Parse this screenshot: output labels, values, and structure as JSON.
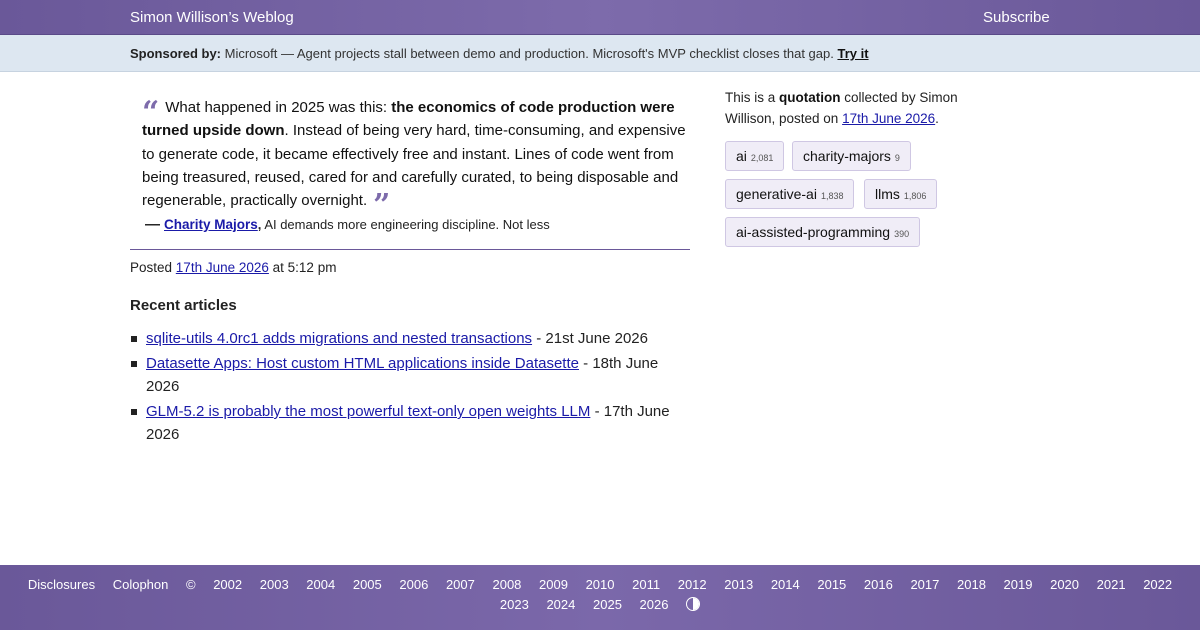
{
  "header": {
    "site_title": "Simon Willison’s Weblog",
    "subscribe": "Subscribe"
  },
  "sponsor": {
    "label": "Sponsored by:",
    "text": "Microsoft — Agent projects stall between demo and production. Microsoft's MVP checklist closes that gap.",
    "link": "Try it"
  },
  "quote": {
    "open_mark": "“",
    "text_before": "What happened in 2025 was this: ",
    "emphasis": "the economics of code production were turned upside down",
    "text_after": ". Instead of being very hard, time-consuming, and expensive to generate code, it became effectively free and instant. Lines of code went from being treasured, reused, cared for and carefully curated, to being disposable and regenerable, practically overnight.",
    "close_mark": "”",
    "cite_dash": "—",
    "author": "Charity Majors",
    "source": "AI demands more engineering discipline. Not less"
  },
  "posted": {
    "prefix": "Posted",
    "date": "17th June 2026",
    "time": "at 5:12 pm"
  },
  "recent": {
    "heading": "Recent articles",
    "items": [
      {
        "title": "sqlite-utils 4.0rc1 adds migrations and nested transactions",
        "date": "- 21st June 2026"
      },
      {
        "title": "Datasette Apps: Host custom HTML applications inside Datasette",
        "date": "- 18th June 2026"
      },
      {
        "title": "GLM-5.2 is probably the most powerful text-only open weights LLM",
        "date": "- 17th June 2026"
      }
    ]
  },
  "sidebar": {
    "about_prefix": "This is a",
    "about_type": "quotation",
    "about_middle": "collected by Simon Willison, posted on",
    "about_date": "17th June 2026",
    "about_end": ".",
    "tags": [
      {
        "name": "ai",
        "count": "2,081"
      },
      {
        "name": "charity-majors",
        "count": "9"
      },
      {
        "name": "generative-ai",
        "count": "1,838"
      },
      {
        "name": "llms",
        "count": "1,806"
      },
      {
        "name": "ai-assisted-programming",
        "count": "390"
      }
    ]
  },
  "footer": {
    "disclosures": "Disclosures",
    "colophon": "Colophon",
    "copyright": "©",
    "years": [
      "2002",
      "2003",
      "2004",
      "2005",
      "2006",
      "2007",
      "2008",
      "2009",
      "2010",
      "2011",
      "2012",
      "2013",
      "2014",
      "2015",
      "2016",
      "2017",
      "2018",
      "2019",
      "2020",
      "2021",
      "2022",
      "2023",
      "2024",
      "2025",
      "2026"
    ],
    "theme_icon": "contrast-icon"
  },
  "colors": {
    "header_purple": "#6a5899",
    "sponsor_bg": "#dde7f1",
    "link_blue": "#1a1aa8",
    "tag_bg": "#f0edf7"
  }
}
